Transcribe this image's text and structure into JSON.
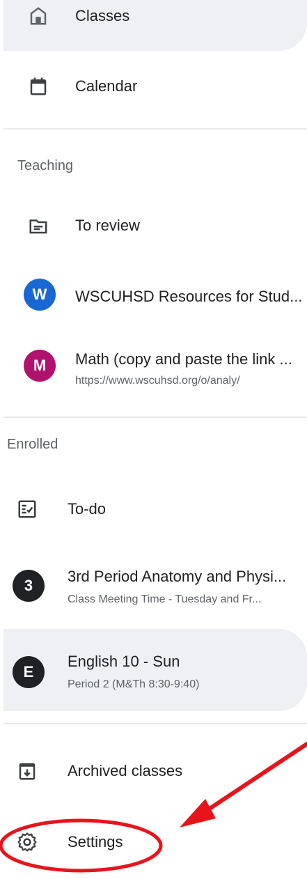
{
  "nav": {
    "classes_label": "Classes",
    "calendar_label": "Calendar"
  },
  "teaching": {
    "header": "Teaching",
    "to_review_label": "To review",
    "classes": [
      {
        "letter": "W",
        "title": "WSCUHSD Resources for Stud...",
        "subtitle": "",
        "color": "#1967d2"
      },
      {
        "letter": "M",
        "title": "Math (copy and paste the link ...",
        "subtitle": "https://www.wscuhsd.org/o/analy/",
        "color": "#b0136f"
      }
    ]
  },
  "enrolled": {
    "header": "Enrolled",
    "todo_label": "To-do",
    "classes": [
      {
        "letter": "3",
        "title": "3rd Period Anatomy and Physi...",
        "subtitle": "Class Meeting Time - Tuesday and Fr...",
        "color": "#202124"
      },
      {
        "letter": "E",
        "title": "English 10 - Sun",
        "subtitle": "Period 2 (M&Th 8:30-9:40)",
        "color": "#202124"
      }
    ]
  },
  "footer": {
    "archived_label": "Archived classes",
    "settings_label": "Settings"
  },
  "colors": {
    "highlight": "#eef0f3",
    "annotation": "#e8141b"
  }
}
